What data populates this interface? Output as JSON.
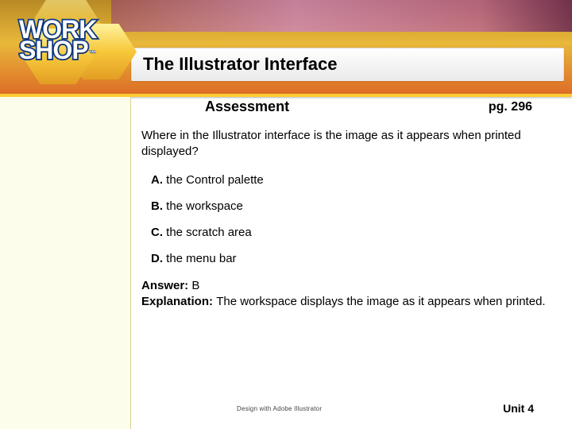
{
  "logo": {
    "line1": "WORK",
    "line2": "SHOP",
    "tm": "™"
  },
  "title": "The Illustrator Interface",
  "subhead": {
    "label": "Assessment",
    "page": "pg. 296"
  },
  "question": "Where in the Illustrator interface is the image as it appears when printed displayed?",
  "options": {
    "a_letter": "A.",
    "a_text": " the Control palette",
    "b_letter": "B.",
    "b_text": " the workspace",
    "c_letter": "C.",
    "c_text": " the scratch area",
    "d_letter": "D.",
    "d_text": " the menu bar"
  },
  "answer": {
    "label": "Answer: ",
    "value": "B",
    "explanation_label": "Explanation: ",
    "explanation_text": "The workspace displays the image as it appears when printed."
  },
  "footer": {
    "credit": "Design with Adobe Illustrator",
    "unit": "Unit 4"
  }
}
